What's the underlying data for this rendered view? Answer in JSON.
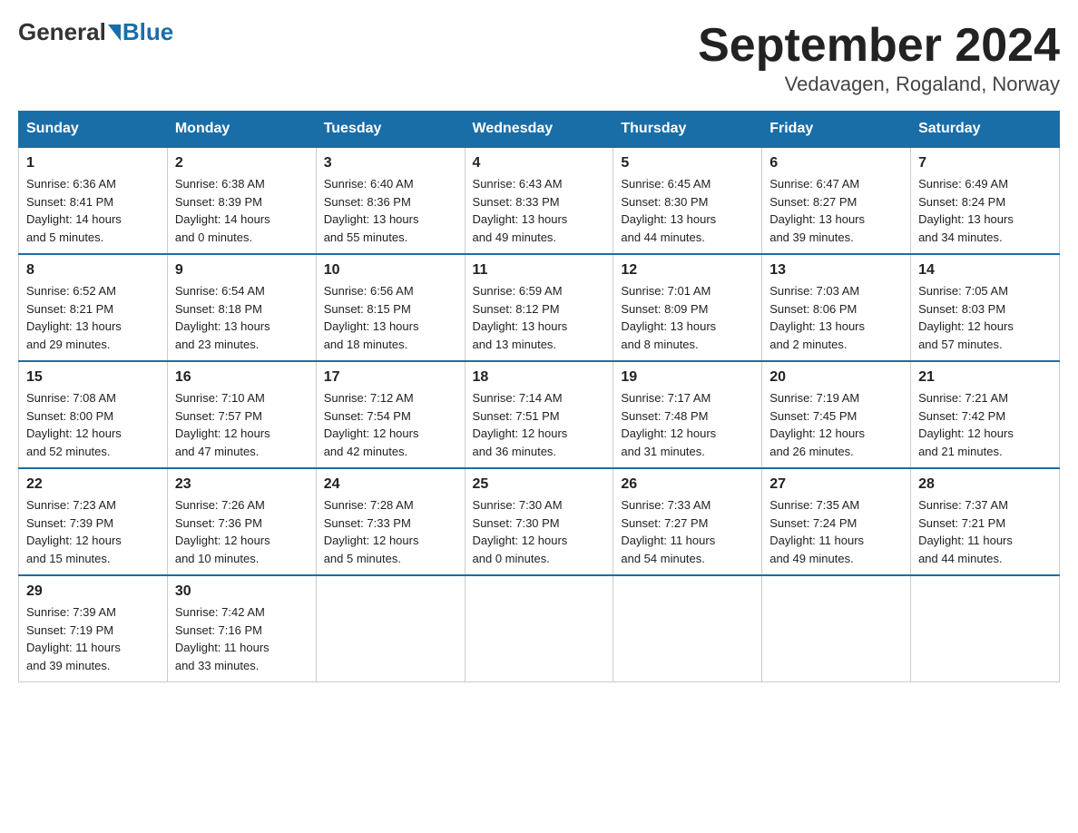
{
  "logo": {
    "general": "General",
    "blue": "Blue"
  },
  "title": "September 2024",
  "location": "Vedavagen, Rogaland, Norway",
  "days_of_week": [
    "Sunday",
    "Monday",
    "Tuesday",
    "Wednesday",
    "Thursday",
    "Friday",
    "Saturday"
  ],
  "weeks": [
    [
      {
        "day": "1",
        "sunrise": "6:36 AM",
        "sunset": "8:41 PM",
        "daylight": "14 hours and 5 minutes."
      },
      {
        "day": "2",
        "sunrise": "6:38 AM",
        "sunset": "8:39 PM",
        "daylight": "14 hours and 0 minutes."
      },
      {
        "day": "3",
        "sunrise": "6:40 AM",
        "sunset": "8:36 PM",
        "daylight": "13 hours and 55 minutes."
      },
      {
        "day": "4",
        "sunrise": "6:43 AM",
        "sunset": "8:33 PM",
        "daylight": "13 hours and 49 minutes."
      },
      {
        "day": "5",
        "sunrise": "6:45 AM",
        "sunset": "8:30 PM",
        "daylight": "13 hours and 44 minutes."
      },
      {
        "day": "6",
        "sunrise": "6:47 AM",
        "sunset": "8:27 PM",
        "daylight": "13 hours and 39 minutes."
      },
      {
        "day": "7",
        "sunrise": "6:49 AM",
        "sunset": "8:24 PM",
        "daylight": "13 hours and 34 minutes."
      }
    ],
    [
      {
        "day": "8",
        "sunrise": "6:52 AM",
        "sunset": "8:21 PM",
        "daylight": "13 hours and 29 minutes."
      },
      {
        "day": "9",
        "sunrise": "6:54 AM",
        "sunset": "8:18 PM",
        "daylight": "13 hours and 23 minutes."
      },
      {
        "day": "10",
        "sunrise": "6:56 AM",
        "sunset": "8:15 PM",
        "daylight": "13 hours and 18 minutes."
      },
      {
        "day": "11",
        "sunrise": "6:59 AM",
        "sunset": "8:12 PM",
        "daylight": "13 hours and 13 minutes."
      },
      {
        "day": "12",
        "sunrise": "7:01 AM",
        "sunset": "8:09 PM",
        "daylight": "13 hours and 8 minutes."
      },
      {
        "day": "13",
        "sunrise": "7:03 AM",
        "sunset": "8:06 PM",
        "daylight": "13 hours and 2 minutes."
      },
      {
        "day": "14",
        "sunrise": "7:05 AM",
        "sunset": "8:03 PM",
        "daylight": "12 hours and 57 minutes."
      }
    ],
    [
      {
        "day": "15",
        "sunrise": "7:08 AM",
        "sunset": "8:00 PM",
        "daylight": "12 hours and 52 minutes."
      },
      {
        "day": "16",
        "sunrise": "7:10 AM",
        "sunset": "7:57 PM",
        "daylight": "12 hours and 47 minutes."
      },
      {
        "day": "17",
        "sunrise": "7:12 AM",
        "sunset": "7:54 PM",
        "daylight": "12 hours and 42 minutes."
      },
      {
        "day": "18",
        "sunrise": "7:14 AM",
        "sunset": "7:51 PM",
        "daylight": "12 hours and 36 minutes."
      },
      {
        "day": "19",
        "sunrise": "7:17 AM",
        "sunset": "7:48 PM",
        "daylight": "12 hours and 31 minutes."
      },
      {
        "day": "20",
        "sunrise": "7:19 AM",
        "sunset": "7:45 PM",
        "daylight": "12 hours and 26 minutes."
      },
      {
        "day": "21",
        "sunrise": "7:21 AM",
        "sunset": "7:42 PM",
        "daylight": "12 hours and 21 minutes."
      }
    ],
    [
      {
        "day": "22",
        "sunrise": "7:23 AM",
        "sunset": "7:39 PM",
        "daylight": "12 hours and 15 minutes."
      },
      {
        "day": "23",
        "sunrise": "7:26 AM",
        "sunset": "7:36 PM",
        "daylight": "12 hours and 10 minutes."
      },
      {
        "day": "24",
        "sunrise": "7:28 AM",
        "sunset": "7:33 PM",
        "daylight": "12 hours and 5 minutes."
      },
      {
        "day": "25",
        "sunrise": "7:30 AM",
        "sunset": "7:30 PM",
        "daylight": "12 hours and 0 minutes."
      },
      {
        "day": "26",
        "sunrise": "7:33 AM",
        "sunset": "7:27 PM",
        "daylight": "11 hours and 54 minutes."
      },
      {
        "day": "27",
        "sunrise": "7:35 AM",
        "sunset": "7:24 PM",
        "daylight": "11 hours and 49 minutes."
      },
      {
        "day": "28",
        "sunrise": "7:37 AM",
        "sunset": "7:21 PM",
        "daylight": "11 hours and 44 minutes."
      }
    ],
    [
      {
        "day": "29",
        "sunrise": "7:39 AM",
        "sunset": "7:19 PM",
        "daylight": "11 hours and 39 minutes."
      },
      {
        "day": "30",
        "sunrise": "7:42 AM",
        "sunset": "7:16 PM",
        "daylight": "11 hours and 33 minutes."
      },
      null,
      null,
      null,
      null,
      null
    ]
  ]
}
